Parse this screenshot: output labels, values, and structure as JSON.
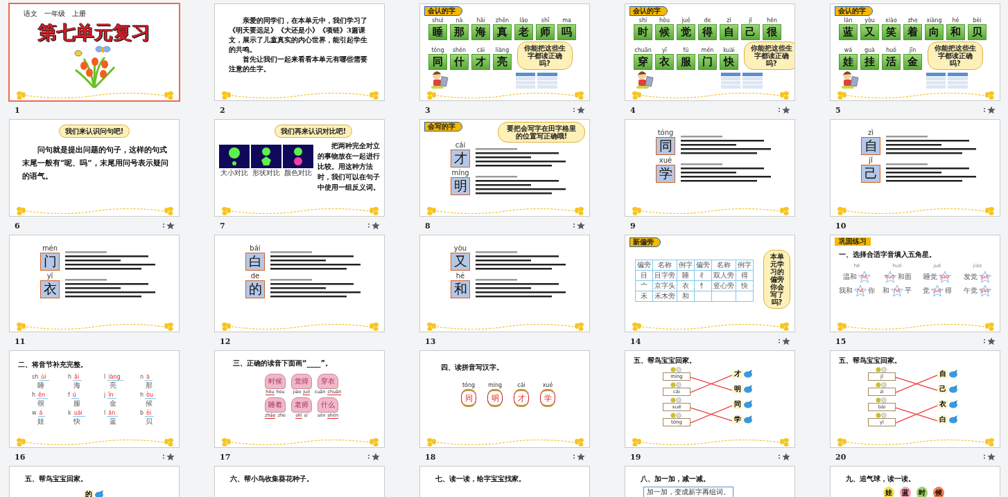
{
  "slides": [
    {
      "number": "1",
      "selected": true,
      "animated": false,
      "kind": "title",
      "header": "语文　一年级　上册",
      "title": "第七单元复习"
    },
    {
      "number": "2",
      "selected": false,
      "animated": false,
      "kind": "paragraph",
      "paragraphs": [
        "亲爱的同学们，在本单元中，我们学习了《明天要远足》《大还是小》《项链》3篇课文，展示了儿童真实的内心世界，能引起学生的共鸣。",
        "首先让我们一起来看看本单元有哪些需要注意的生字。"
      ]
    },
    {
      "number": "3",
      "selected": false,
      "animated": true,
      "kind": "recognize",
      "tag": "会认的字",
      "bubble": "你能把这些生字都读正确吗?",
      "rows": [
        [
          {
            "pinyin": "shuì",
            "char": "睡"
          },
          {
            "pinyin": "nà",
            "char": "那"
          },
          {
            "pinyin": "hǎi",
            "char": "海"
          },
          {
            "pinyin": "zhēn",
            "char": "真"
          },
          {
            "pinyin": "lǎo",
            "char": "老"
          },
          {
            "pinyin": "shī",
            "char": "师"
          },
          {
            "pinyin": "ma",
            "char": "吗"
          }
        ],
        [
          {
            "pinyin": "tóng",
            "char": "同"
          },
          {
            "pinyin": "shén",
            "char": "什"
          },
          {
            "pinyin": "cái",
            "char": "才"
          },
          {
            "pinyin": "liàng",
            "char": "亮"
          }
        ]
      ]
    },
    {
      "number": "4",
      "selected": false,
      "animated": true,
      "kind": "recognize",
      "tag": "会认的字",
      "bubble": "你能把这些生字都读正确吗?",
      "rows": [
        [
          {
            "pinyin": "shí",
            "char": "时"
          },
          {
            "pinyin": "hòu",
            "char": "候"
          },
          {
            "pinyin": "jué",
            "char": "觉"
          },
          {
            "pinyin": "de",
            "char": "得"
          },
          {
            "pinyin": "zì",
            "char": "自"
          },
          {
            "pinyin": "jǐ",
            "char": "己"
          },
          {
            "pinyin": "hěn",
            "char": "很"
          }
        ],
        [
          {
            "pinyin": "chuān",
            "char": "穿"
          },
          {
            "pinyin": "yī",
            "char": "衣"
          },
          {
            "pinyin": "fú",
            "char": "服"
          },
          {
            "pinyin": "mén",
            "char": "门"
          },
          {
            "pinyin": "kuài",
            "char": "快"
          }
        ]
      ]
    },
    {
      "number": "5",
      "selected": false,
      "animated": true,
      "kind": "recognize",
      "tag": "会认的字",
      "bubble": "你能把这些生字都读正确吗?",
      "rows": [
        [
          {
            "pinyin": "lán",
            "char": "蓝"
          },
          {
            "pinyin": "yòu",
            "char": "又"
          },
          {
            "pinyin": "xiào",
            "char": "笑"
          },
          {
            "pinyin": "zhe",
            "char": "着"
          },
          {
            "pinyin": "xiàng",
            "char": "向"
          },
          {
            "pinyin": "hé",
            "char": "和"
          },
          {
            "pinyin": "bèi",
            "char": "贝"
          }
        ],
        [
          {
            "pinyin": "wá",
            "char": "娃"
          },
          {
            "pinyin": "guà",
            "char": "挂"
          },
          {
            "pinyin": "huó",
            "char": "活"
          },
          {
            "pinyin": "jīn",
            "char": "金"
          }
        ]
      ]
    },
    {
      "number": "6",
      "selected": false,
      "animated": true,
      "kind": "bubble_text",
      "bubble": "我们来认识问句吧!",
      "paragraph": "问句就是提出问题的句子，这样的句式末尾一般有“呢、吗”，末尾用问号表示疑问的语气。"
    },
    {
      "number": "7",
      "selected": false,
      "animated": true,
      "kind": "bubble_text",
      "bubble": "我们再来认识对比吧!",
      "paragraph": "把两种完全对立的事物放在一起进行比较。用这种方法时，我们可以在句子中使用一组反义词。",
      "panels": [
        {
          "kind": "size",
          "caption": "大小对比"
        },
        {
          "kind": "shape",
          "caption": "形状对比"
        },
        {
          "kind": "color",
          "caption": "颜色对比"
        }
      ]
    },
    {
      "number": "8",
      "selected": false,
      "animated": true,
      "kind": "write",
      "tag": "会写的字",
      "bubble": "要把会写字在田字格里的位置写正确哦!",
      "chars": [
        {
          "pinyin": "cái",
          "char": "才"
        },
        {
          "pinyin": "míng",
          "char": "明"
        }
      ]
    },
    {
      "number": "9",
      "selected": false,
      "animated": false,
      "kind": "write",
      "chars": [
        {
          "pinyin": "tóng",
          "char": "同"
        },
        {
          "pinyin": "xué",
          "char": "学"
        }
      ]
    },
    {
      "number": "10",
      "selected": false,
      "animated": false,
      "kind": "write",
      "chars": [
        {
          "pinyin": "zì",
          "char": "自"
        },
        {
          "pinyin": "jǐ",
          "char": "己"
        }
      ]
    },
    {
      "number": "11",
      "selected": false,
      "animated": false,
      "kind": "write",
      "chars": [
        {
          "pinyin": "mén",
          "char": "门"
        },
        {
          "pinyin": "yī",
          "char": "衣"
        }
      ]
    },
    {
      "number": "12",
      "selected": false,
      "animated": false,
      "kind": "write",
      "chars": [
        {
          "pinyin": "bái",
          "char": "白"
        },
        {
          "pinyin": "de",
          "char": "的"
        }
      ]
    },
    {
      "number": "13",
      "selected": false,
      "animated": false,
      "kind": "write",
      "chars": [
        {
          "pinyin": "yòu",
          "char": "又"
        },
        {
          "pinyin": "hé",
          "char": "和"
        }
      ]
    },
    {
      "number": "14",
      "selected": false,
      "animated": true,
      "kind": "radicals",
      "tag": "新偏旁",
      "bubble": "本单元学习的偏旁你会写了吗?",
      "header": [
        "偏旁",
        "名称",
        "例字",
        "偏旁",
        "名称",
        "例字"
      ],
      "rows": [
        [
          "目",
          "目字旁",
          "睡",
          "彳",
          "双人旁",
          "得"
        ],
        [
          "亠",
          "京字头",
          "衣",
          "忄",
          "竖心旁",
          "快"
        ],
        [
          "禾",
          "禾木旁",
          "和"
        ]
      ]
    },
    {
      "number": "15",
      "selected": false,
      "animated": true,
      "kind": "stars",
      "tag": "巩固练习",
      "heading": "一、选择合适字音填入五角星。",
      "columns": [
        {
          "pinyin": "hé",
          "rows": [
            {
              "before": "温和",
              "star": "hé"
            },
            {
              "before": "我和",
              "star": "hé",
              "after": "你"
            }
          ]
        },
        {
          "pinyin": "huó",
          "rows": [
            {
              "star": "huó",
              "after": "和面"
            },
            {
              "before": "和",
              "star": "hé",
              "after": "平"
            }
          ]
        },
        {
          "pinyin": "jué",
          "rows": [
            {
              "before": "睡觉",
              "star": "jiào"
            },
            {
              "before": "觉",
              "star": "jué",
              "after": "得"
            }
          ]
        },
        {
          "pinyin": "jiào",
          "rows": [
            {
              "before": "发觉",
              "star": "jué"
            },
            {
              "before": "午觉",
              "star": "jiào"
            }
          ]
        }
      ]
    },
    {
      "number": "16",
      "selected": false,
      "animated": true,
      "kind": "syllables",
      "heading": "二、将音节补充完整。",
      "items": [
        {
          "initial": "sh",
          "final": "ùi",
          "char": "睡"
        },
        {
          "initial": "h",
          "final": "ǎi",
          "char": "海"
        },
        {
          "initial": "l",
          "final": "iàng",
          "char": "亮"
        },
        {
          "initial": "n",
          "final": "à",
          "char": "那"
        },
        {
          "initial": "h",
          "final": "ěn",
          "char": "很"
        },
        {
          "initial": "f",
          "final": "ú",
          "char": "服"
        },
        {
          "initial": "j",
          "final": "īn",
          "char": "金"
        },
        {
          "initial": "h",
          "final": "òu",
          "char": "候"
        },
        {
          "initial": "w",
          "final": "á",
          "char": "娃"
        },
        {
          "initial": "k",
          "final": "uài",
          "char": "快"
        },
        {
          "initial": "l",
          "final": "án",
          "char": "蓝"
        },
        {
          "initial": "b",
          "final": "èi",
          "char": "贝"
        }
      ]
    },
    {
      "number": "17",
      "selected": false,
      "animated": true,
      "kind": "bears",
      "heading": "三、正确的读音下面画“____”。",
      "bears": [
        {
          "word": "时候",
          "options": [
            {
              "text": "hòu",
              "selected": true
            },
            {
              "text": "hou",
              "selected": false
            }
          ]
        },
        {
          "word": "觉得",
          "options": [
            {
              "text": "jiào",
              "selected": false
            },
            {
              "text": "jué",
              "selected": true
            }
          ]
        },
        {
          "word": "穿衣",
          "options": [
            {
              "text": "cuān",
              "selected": false
            },
            {
              "text": "chuān",
              "selected": true
            }
          ]
        },
        {
          "word": "睡着",
          "options": [
            {
              "text": "zháo",
              "selected": true
            },
            {
              "text": "zhe",
              "selected": false
            }
          ]
        },
        {
          "word": "老师",
          "options": [
            {
              "text": "shī",
              "selected": true
            },
            {
              "text": "sī",
              "selected": false
            }
          ]
        },
        {
          "word": "什么",
          "options": [
            {
              "text": "sén",
              "selected": false
            },
            {
              "text": "shén",
              "selected": true
            }
          ]
        }
      ]
    },
    {
      "number": "18",
      "selected": false,
      "animated": true,
      "kind": "lanterns",
      "heading": "四、读拼音写汉字。",
      "items": [
        {
          "pinyin": "tóng",
          "char": "同"
        },
        {
          "pinyin": "míng",
          "char": "明"
        },
        {
          "pinyin": "cái",
          "char": "才"
        },
        {
          "pinyin": "xué",
          "char": "学"
        }
      ]
    },
    {
      "number": "19",
      "selected": false,
      "animated": true,
      "kind": "match",
      "heading": "五、帮鸟宝宝回家。",
      "left": [
        {
          "pinyin": "míng",
          "descends": true
        },
        {
          "pinyin": "cái",
          "descends": false
        },
        {
          "pinyin": "xué",
          "descends": true
        },
        {
          "pinyin": "tóng",
          "descends": false
        }
      ],
      "right": [
        "才",
        "明",
        "同",
        "学"
      ]
    },
    {
      "number": "20",
      "selected": false,
      "animated": true,
      "kind": "match",
      "heading": "五、帮鸟宝宝回家。",
      "left": [
        {
          "pinyin": "jǐ",
          "descends": true
        },
        {
          "pinyin": "zì",
          "descends": false
        },
        {
          "pinyin": "bái",
          "descends": true
        },
        {
          "pinyin": "yī",
          "descends": false
        }
      ],
      "right": [
        "自",
        "己",
        "衣",
        "白"
      ]
    },
    {
      "selected": false,
      "kind": "exercise",
      "heading": "五、帮鸟宝宝回家。",
      "chars": [
        "的"
      ]
    },
    {
      "selected": false,
      "kind": "exercise",
      "heading": "六、帮小鸟收集葵花种子。"
    },
    {
      "selected": false,
      "kind": "exercise",
      "heading": "七、读一读，给字宝宝找家。"
    },
    {
      "selected": false,
      "kind": "exercise",
      "heading": "八、加一加，减一减。",
      "note": "加一加，变成新字再组词。"
    },
    {
      "selected": false,
      "kind": "exercise",
      "heading": "九、追气球，读一读。",
      "balloons": [
        "娃",
        "蓝",
        "时",
        "候"
      ]
    }
  ]
}
